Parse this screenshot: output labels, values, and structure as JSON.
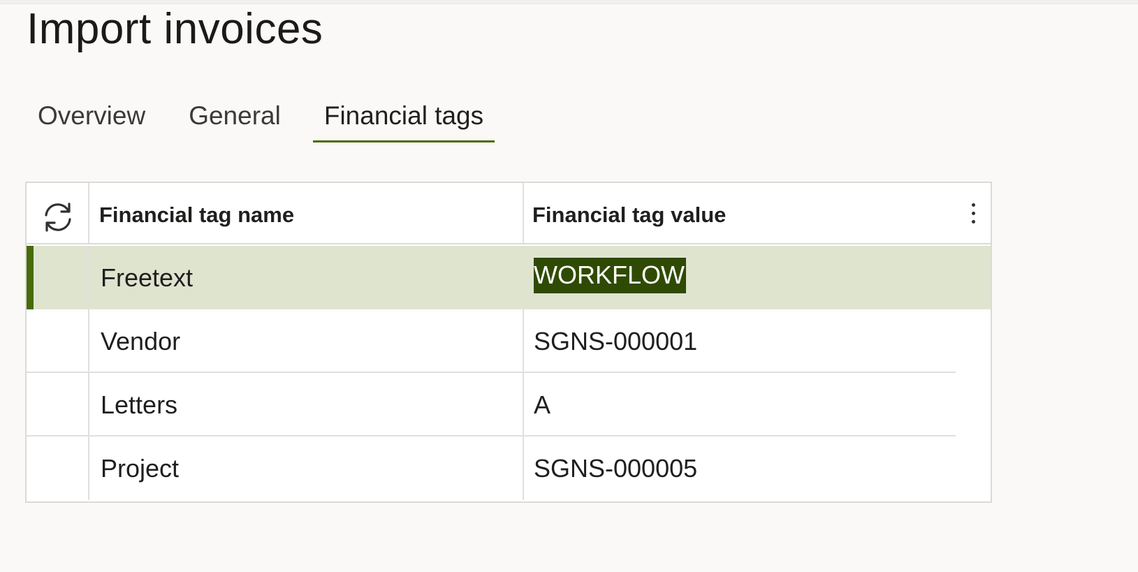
{
  "page": {
    "title": "Import invoices"
  },
  "tabs": [
    {
      "label": "Overview",
      "active": false
    },
    {
      "label": "General",
      "active": false
    },
    {
      "label": "Financial tags",
      "active": true
    }
  ],
  "grid": {
    "refresh_icon": "refresh-icon",
    "more_icon": "more-vertical-icon",
    "columns": [
      "Financial tag name",
      "Financial tag value"
    ],
    "rows": [
      {
        "name": "Freetext",
        "value": "WORKFLOW",
        "selected": true
      },
      {
        "name": "Vendor",
        "value": "SGNS-000001",
        "selected": false
      },
      {
        "name": "Letters",
        "value": "A",
        "selected": false
      },
      {
        "name": "Project",
        "value": "SGNS-000005",
        "selected": false
      }
    ]
  },
  "colors": {
    "accent": "#4a6b0a",
    "selected_row": "#dfe4cf",
    "text_highlight": "#2f4a02",
    "page_background": "#faf9f8"
  }
}
